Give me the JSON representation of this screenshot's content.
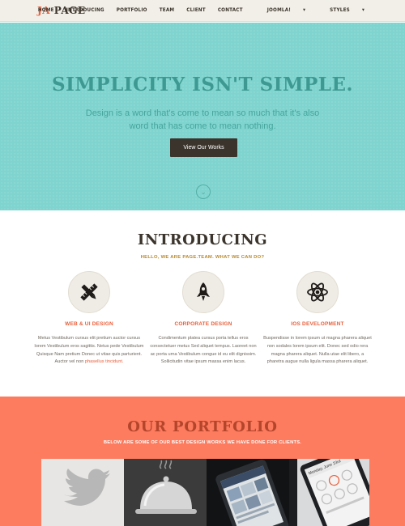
{
  "nav": {
    "logo_prefix": "JA",
    "logo_main": "PAGE",
    "items": [
      {
        "label": "HOME"
      },
      {
        "label": "INTRODUCING"
      },
      {
        "label": "PORTFOLIO"
      },
      {
        "label": "TEAM"
      },
      {
        "label": "CLIENT"
      },
      {
        "label": "CONTACT"
      },
      {
        "label": "JOOMLA!"
      },
      {
        "label": "STYLES"
      }
    ]
  },
  "hero": {
    "title": "SIMPLICITY ISN'T SIMPLE.",
    "subtitle": "Design is a word that's come to mean so much that it's also word that has come to mean nothing.",
    "button_label": "View Our Works",
    "icon": "chevron-down-circle-icon"
  },
  "intro": {
    "title": "INTRODUCING",
    "subtitle": "HELLO, WE ARE PAGE.TEAM. WHAT WE CAN DO?",
    "columns": [
      {
        "icon": "pencil-ruler-icon",
        "title": "WEB & UI DESIGN",
        "text": "Metus Vestibulum cursus elit pretium auctor cursus lorem Vestibulum eros sagittis. Netus pede Vestibulum Quisque Nam pretium Donec ut vitae quis parturient. Auctor vel non",
        "link": "phasellus tincidunt."
      },
      {
        "icon": "rocket-icon",
        "title": "CORPORATE DESIGN",
        "text": "Condimentum platea cursus porta tellus eros consectetuer metus Sed aliquet tempus. Laoreet non ac porta urna Vestibulum congue id eu elit dignissim. Sollicitudin vitae ipsum massa enim lacus."
      },
      {
        "icon": "atom-icon",
        "title": "IOS DEVELOPMENT",
        "text": "Buspendisse in lorem ipsum ut magna pharera aliquet non sodales lorem ipsum elit. Donec sed odio rera magna pharera aliquet. Nulla utae elit libero, a pharetra augue nulla ligula massa pharera aliquet."
      }
    ]
  },
  "portfolio": {
    "title": "OUR PORTFOLIO",
    "subtitle": "BELOW ARE SOME OF OUR BEST DESIGN WORKS WE HAVE DONE FOR CLIENTS.",
    "tiles": [
      {
        "icon": "twitter-bird-icon"
      },
      {
        "icon": "cloche-icon"
      },
      {
        "icon": "phone-app-screenshot"
      },
      {
        "icon": "phone-app-screenshot"
      }
    ],
    "phone_header": "Monday, June 23rd"
  },
  "colors": {
    "accent": "#e8603c",
    "hero_bg": "#7fd4cf",
    "hero_text": "#3e9992",
    "dark": "#3b342c",
    "portfolio_bg": "#fd7b5e",
    "portfolio_title": "#b3452b",
    "gold": "#b9892a"
  }
}
